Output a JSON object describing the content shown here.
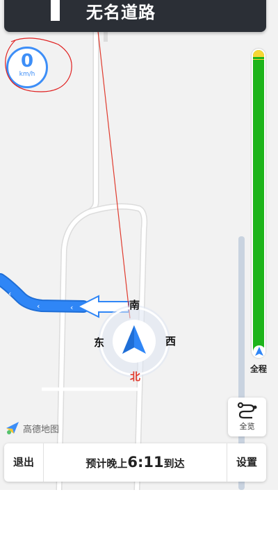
{
  "top_banner": {
    "road_name": "无名道路"
  },
  "speedometer": {
    "value": "0",
    "unit": "km/h"
  },
  "compass": {
    "north": "北",
    "south": "南",
    "east": "东",
    "west": "西"
  },
  "route_progress": {
    "label": "全程",
    "colors": {
      "traveled": "#1db41a",
      "upcoming": "#f7d634"
    }
  },
  "overview_button": {
    "label": "全览"
  },
  "logo": {
    "text": "高德地图"
  },
  "bottom_bar": {
    "exit_label": "退出",
    "eta_prefix": "预计晚上",
    "eta_time": "6:11",
    "eta_suffix": "到达",
    "settings_label": "设置"
  },
  "colors": {
    "route": "#2f86f6",
    "accent": "#3d8ef7",
    "banner": "#2b2f36"
  }
}
